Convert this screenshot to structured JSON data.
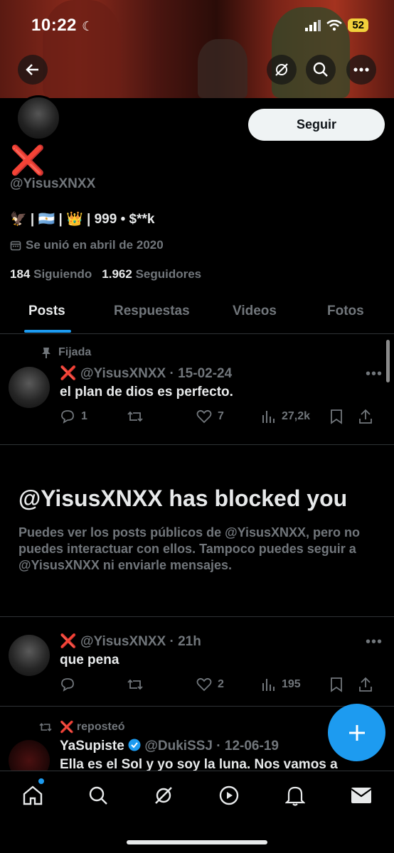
{
  "status_bar": {
    "time": "10:22",
    "battery": "52"
  },
  "profile": {
    "name": "❌",
    "handle": "@YisusXNXX",
    "bio": "🦅 | 🇦🇷 | 👑 | 999 • $**k",
    "joined": "Se unió en abril de 2020",
    "following_count": "184",
    "following_label": "Siguiendo",
    "followers_count": "1.962",
    "followers_label": "Seguidores",
    "follow_label": "Seguir"
  },
  "tabs": [
    {
      "label": "Posts"
    },
    {
      "label": "Respuestas"
    },
    {
      "label": "Videos"
    },
    {
      "label": "Fotos"
    }
  ],
  "pinned_post": {
    "pinned_label": "Fijada",
    "author_x": "❌",
    "author": "@YisusXNXX",
    "date": "· 15-02-24",
    "text": "el plan de dios es perfecto.",
    "replies": "1",
    "reposts": "",
    "likes": "7",
    "views": "27,2k"
  },
  "blocked": {
    "title": "@YisusXNXX has blocked you",
    "description": "Puedes ver los posts públicos de @YisusXNXX, pero no puedes interactuar con ellos. Tampoco puedes seguir a @YisusXNXX ni enviarle mensajes."
  },
  "post2": {
    "author_x": "❌",
    "author": "@YisusXNXX",
    "date": "· 21h",
    "text": "que pena",
    "replies": "",
    "reposts": "",
    "likes": "2",
    "views": "195"
  },
  "repost": {
    "repost_x": "❌",
    "repost_label": "reposteó",
    "display_name": "YaSupiste",
    "handle": "@DukiSSJ",
    "date": "· 12-06-19",
    "text": "Ella es el Sol y yo soy la luna. Nos vamos a"
  },
  "colors": {
    "accent": "#1d9bf0",
    "muted": "#71767b",
    "text": "#e7e9ea",
    "red_x": "#e0242c"
  },
  "icons": [
    "back-arrow-icon",
    "grok-icon",
    "search-icon",
    "more-icon",
    "calendar-icon",
    "pin-icon",
    "reply-icon",
    "repost-icon",
    "like-icon",
    "views-icon",
    "bookmark-icon",
    "share-icon",
    "verified-icon",
    "compose-icon",
    "home-icon",
    "explore-icon",
    "grok-icon",
    "video-icon",
    "notifications-icon",
    "messages-icon"
  ]
}
